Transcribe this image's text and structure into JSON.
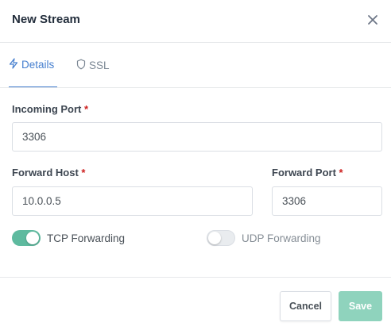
{
  "dialog": {
    "title": "New Stream"
  },
  "tabs": [
    {
      "label": "Details",
      "icon": "bolt-icon",
      "active": true
    },
    {
      "label": "SSL",
      "icon": "shield-icon",
      "active": false
    }
  ],
  "form": {
    "required_marker": "*",
    "incoming_port": {
      "label": "Incoming Port",
      "value": "3306"
    },
    "forward_host": {
      "label": "Forward Host",
      "value": "10.0.0.5"
    },
    "forward_port": {
      "label": "Forward Port",
      "value": "3306"
    },
    "tcp_forwarding": {
      "label": "TCP Forwarding",
      "enabled": true
    },
    "udp_forwarding": {
      "label": "UDP Forwarding",
      "enabled": false
    }
  },
  "footer": {
    "cancel_label": "Cancel",
    "save_label": "Save"
  },
  "colors": {
    "accent": "#467fcf",
    "toggle_on": "#5eba9f",
    "save_button": "#8fd3bd",
    "required": "#cd201f"
  }
}
